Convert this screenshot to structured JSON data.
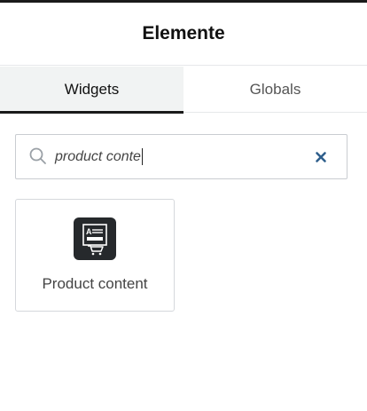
{
  "header": {
    "title": "Elemente"
  },
  "tabs": [
    {
      "label": "Widgets",
      "active": true
    },
    {
      "label": "Globals",
      "active": false
    }
  ],
  "search": {
    "value": "product conte",
    "placeholder": ""
  },
  "widgets": [
    {
      "label": "Product content",
      "icon": "product-content-icon"
    }
  ],
  "colors": {
    "icon_bg": "#26292c",
    "clear_icon": "#2f5f8c",
    "active_tab_bg": "#f1f3f3",
    "active_tab_underline": "#1a1a1a"
  }
}
